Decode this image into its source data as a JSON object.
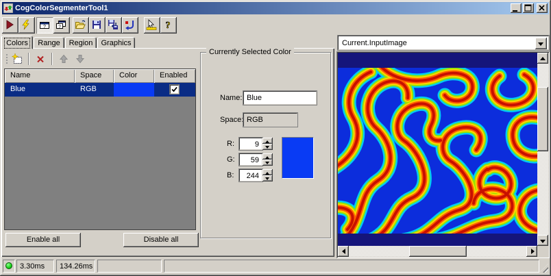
{
  "window": {
    "title": "CogColorSegmenterTool1"
  },
  "toolbar": {
    "icons": [
      "run-icon",
      "live-run-icon",
      "image-panel-toggle-icon",
      "float-panel-icon",
      "open-file-icon",
      "save-file-icon",
      "save-image-icon",
      "reset-icon",
      "position-tool-icon",
      "help-icon"
    ]
  },
  "tabs": {
    "items": [
      "Colors",
      "Range",
      "Region",
      "Graphics"
    ],
    "active": "Colors"
  },
  "color_list": {
    "toolbar_icons": [
      "add-color-icon",
      "delete-color-icon",
      "move-up-icon",
      "move-down-icon"
    ],
    "columns": [
      "Name",
      "Space",
      "Color",
      "Enabled"
    ],
    "rows": [
      {
        "name": "Blue",
        "space": "RGB",
        "color_hex": "#093BF4",
        "enabled": true
      }
    ]
  },
  "selected_color": {
    "group_title": "Currently Selected Color",
    "name_label": "Name:",
    "name_value": "Blue",
    "space_label": "Space:",
    "space_value": "RGB",
    "r_label": "R:",
    "r_value": "9",
    "g_label": "G:",
    "g_value": "59",
    "b_label": "B:",
    "b_value": "244",
    "swatch_hex": "#093BF4"
  },
  "actions": {
    "enable_all": "Enable all",
    "disable_all": "Disable all"
  },
  "viewer": {
    "selected_source": "Current.InputImage"
  },
  "status_bar": {
    "exec_time": "3.30ms",
    "total_time": "134.26ms",
    "led_color": "#17D117"
  },
  "colors": {
    "titlebar_gradient_start": "#0A246A",
    "titlebar_gradient_end": "#A6CAF0",
    "row_selection": "#0A2C85",
    "viewer_background": "#15157B",
    "face": "#D4D0C8"
  }
}
